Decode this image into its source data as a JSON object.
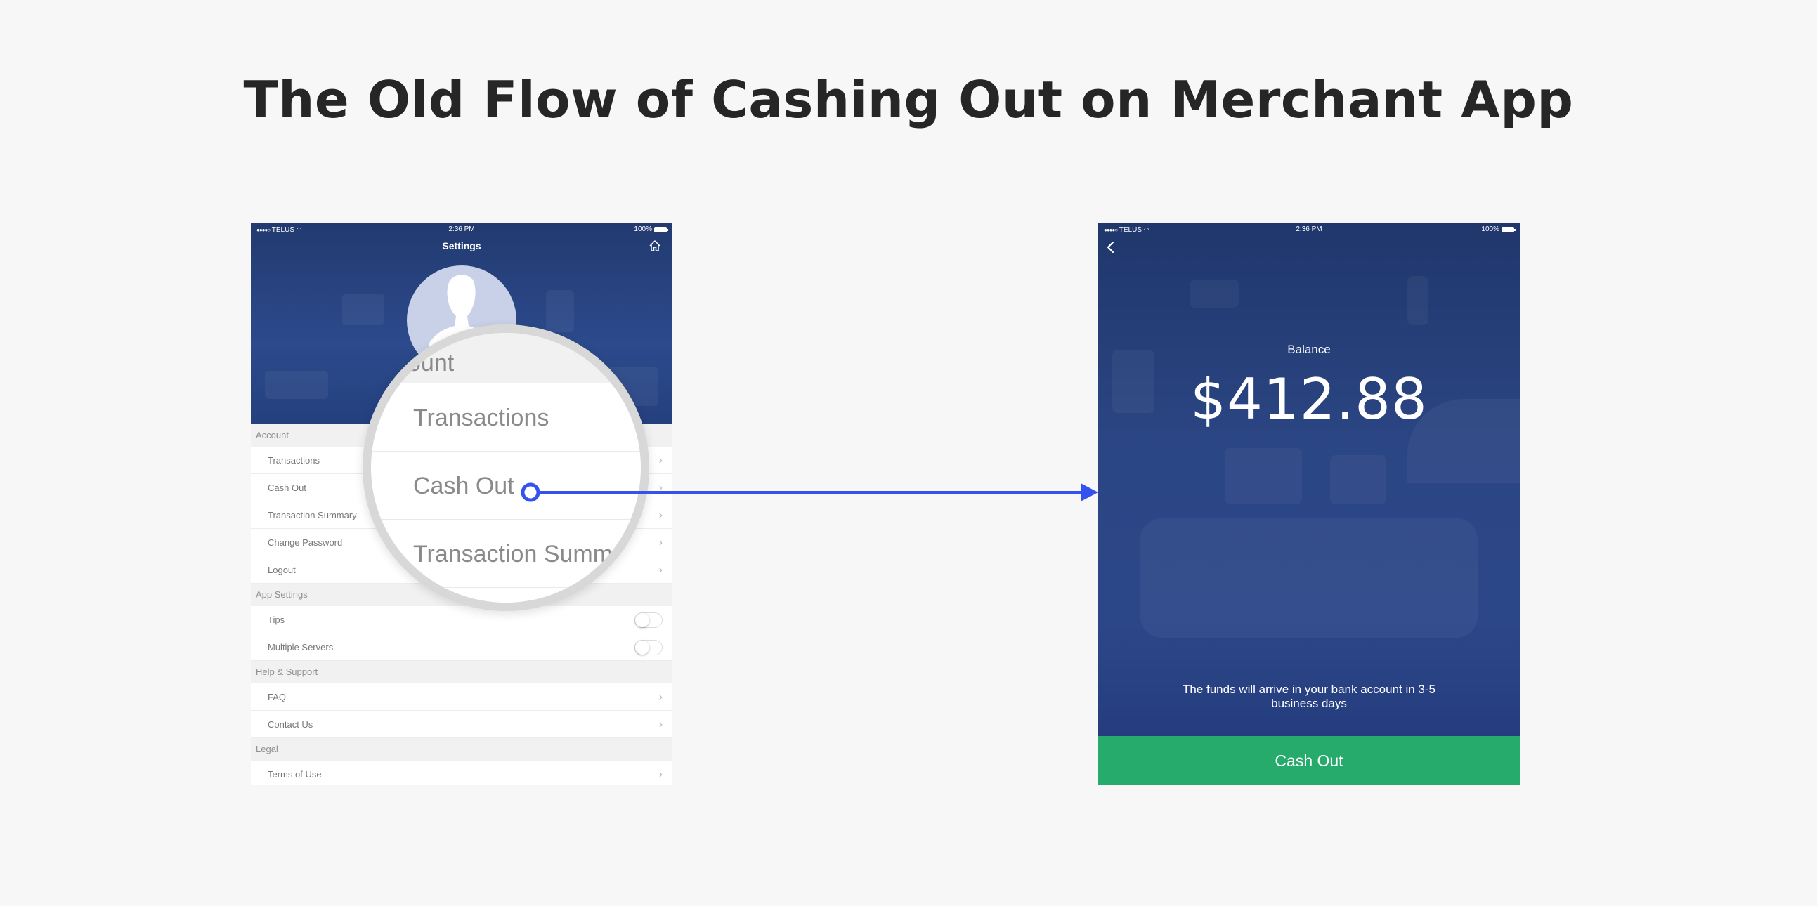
{
  "page": {
    "title": "The Old Flow of Cashing Out on Merchant App"
  },
  "status_bar": {
    "carrier": "TELUS",
    "time": "2:36 PM",
    "battery": "100%"
  },
  "settings_screen": {
    "title": "Settings",
    "sections": [
      {
        "header": "Account",
        "items": [
          "Transactions",
          "Cash Out",
          "Transaction Summary",
          "Change Password",
          "Logout"
        ]
      },
      {
        "header": "App Settings",
        "toggles": [
          "Tips",
          "Multiple Servers"
        ]
      },
      {
        "header": "Help & Support",
        "items": [
          "FAQ",
          "Contact Us"
        ]
      },
      {
        "header": "Legal",
        "items": [
          "Terms of Use"
        ]
      }
    ]
  },
  "magnifier": {
    "section_fragment": "ount",
    "items": [
      "Transactions",
      "Cash Out",
      "Transaction Summ"
    ]
  },
  "cashout_screen": {
    "balance_label": "Balance",
    "balance_amount": "$412.88",
    "note": "The funds will arrive in your bank account in 3-5 business days",
    "button_label": "Cash Out"
  },
  "colors": {
    "connector": "#3452f0",
    "cashout_button": "#27ab6c",
    "header_blue": "#2a4585"
  },
  "icons": {
    "home": "home-icon",
    "back": "chevron-left-icon",
    "row": "chevron-right-icon"
  }
}
